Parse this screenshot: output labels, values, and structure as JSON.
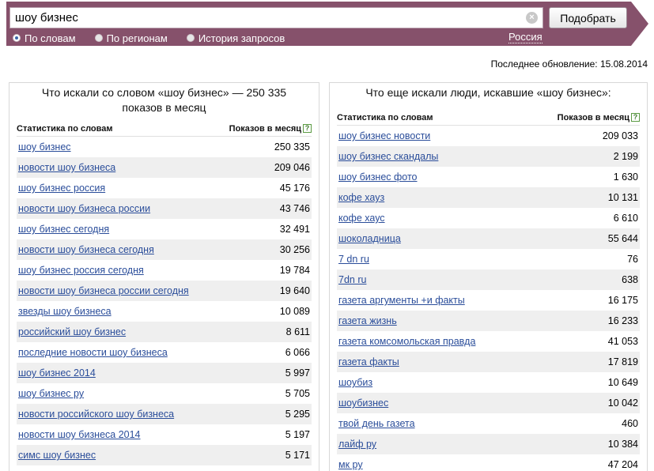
{
  "search": {
    "query": "шоу бизнес",
    "submit_label": "Подобрать",
    "clear_symbol": "×"
  },
  "modes": [
    {
      "label": "По словам",
      "selected": true
    },
    {
      "label": "По регионам",
      "selected": false
    },
    {
      "label": "История запросов",
      "selected": false
    }
  ],
  "region": "Россия",
  "last_update": "Последнее обновление: 15.08.2014",
  "left": {
    "title": "Что искали со словом «шоу бизнес» — 250 335 показов в месяц",
    "col_phrase": "Статистика по словам",
    "col_count": "Показов в месяц",
    "help": "?",
    "rows": [
      {
        "phrase": "шоу бизнес",
        "count": "250 335"
      },
      {
        "phrase": "новости шоу бизнеса",
        "count": "209 046"
      },
      {
        "phrase": "шоу бизнес россия",
        "count": "45 176"
      },
      {
        "phrase": "новости шоу бизнеса россии",
        "count": "43 746"
      },
      {
        "phrase": "шоу бизнес сегодня",
        "count": "32 491"
      },
      {
        "phrase": "новости шоу бизнеса сегодня",
        "count": "30 256"
      },
      {
        "phrase": "шоу бизнес россия сегодня",
        "count": "19 784"
      },
      {
        "phrase": "новости шоу бизнеса россии сегодня",
        "count": "19 640"
      },
      {
        "phrase": "звезды шоу бизнеса",
        "count": "10 089"
      },
      {
        "phrase": "российский шоу бизнес",
        "count": "8 611"
      },
      {
        "phrase": "последние новости шоу бизнеса",
        "count": "6 066"
      },
      {
        "phrase": "шоу бизнес 2014",
        "count": "5 997"
      },
      {
        "phrase": "шоу бизнес ру",
        "count": "5 705"
      },
      {
        "phrase": "новости российского шоу бизнеса",
        "count": "5 295"
      },
      {
        "phrase": "новости шоу бизнеса 2014",
        "count": "5 197"
      },
      {
        "phrase": "симс шоу бизнес",
        "count": "5 171"
      }
    ]
  },
  "right": {
    "title": "Что еще искали люди, искавшие «шоу бизнес»:",
    "col_phrase": "Статистика по словам",
    "col_count": "Показов в месяц",
    "help": "?",
    "rows": [
      {
        "phrase": "шоу бизнес новости",
        "count": "209 033"
      },
      {
        "phrase": "шоу бизнес скандалы",
        "count": "2 199"
      },
      {
        "phrase": "шоу бизнес фото",
        "count": "1 630"
      },
      {
        "phrase": "кофе хауз",
        "count": "10 131"
      },
      {
        "phrase": "кофе хаус",
        "count": "6 610"
      },
      {
        "phrase": "шоколадница",
        "count": "55 644"
      },
      {
        "phrase": "7 dn ru",
        "count": "76"
      },
      {
        "phrase": "7dn ru",
        "count": "638"
      },
      {
        "phrase": "газета аргументы +и факты",
        "count": "16 175"
      },
      {
        "phrase": "газета жизнь",
        "count": "16 233"
      },
      {
        "phrase": "газета комсомольская правда",
        "count": "41 053"
      },
      {
        "phrase": "газета факты",
        "count": "17 819"
      },
      {
        "phrase": "шоубиз",
        "count": "10 649"
      },
      {
        "phrase": "шоубизнес",
        "count": "10 042"
      },
      {
        "phrase": "твой день газета",
        "count": "460"
      },
      {
        "phrase": "лайф ру",
        "count": "10 384"
      },
      {
        "phrase": "мк ру",
        "count": "47 204"
      }
    ]
  }
}
